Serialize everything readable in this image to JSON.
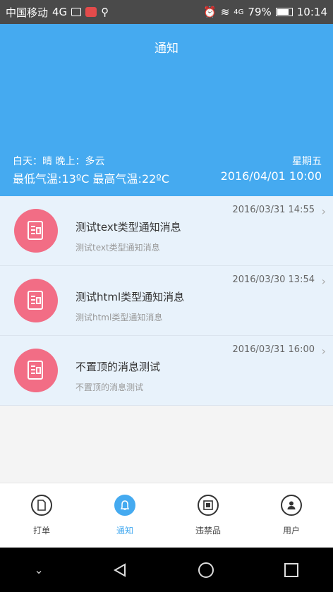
{
  "status_bar": {
    "carrier": "中国移动",
    "network": "4G",
    "signal_label": "4G",
    "battery": "79%",
    "time": "10:14"
  },
  "header": {
    "title": "通知",
    "weather": "白天：晴 晚上：多云",
    "weekday": "星期五",
    "temperature": "最低气温:13ºC 最高气温:22ºC",
    "datetime": "2016/04/01 10:00",
    "background": "#45aaf0"
  },
  "notifications": [
    {
      "title": "测试text类型通知消息",
      "subtitle": "测试text类型通知消息",
      "time": "2016/03/31 14:55"
    },
    {
      "title": "测试html类型通知消息",
      "subtitle": "测试html类型通知消息",
      "time": "2016/03/30 13:54"
    },
    {
      "title": "不置顶的消息测试",
      "subtitle": "不置顶的消息测试",
      "time": "2016/03/31 16:00"
    }
  ],
  "bottom_nav": [
    {
      "label": "打单",
      "icon": "document-icon"
    },
    {
      "label": "通知",
      "icon": "bell-icon",
      "active": true
    },
    {
      "label": "违禁品",
      "icon": "image-icon"
    },
    {
      "label": "用户",
      "icon": "user-icon"
    }
  ],
  "colors": {
    "accent": "#45aaf0",
    "avatar": "#f26d85"
  }
}
